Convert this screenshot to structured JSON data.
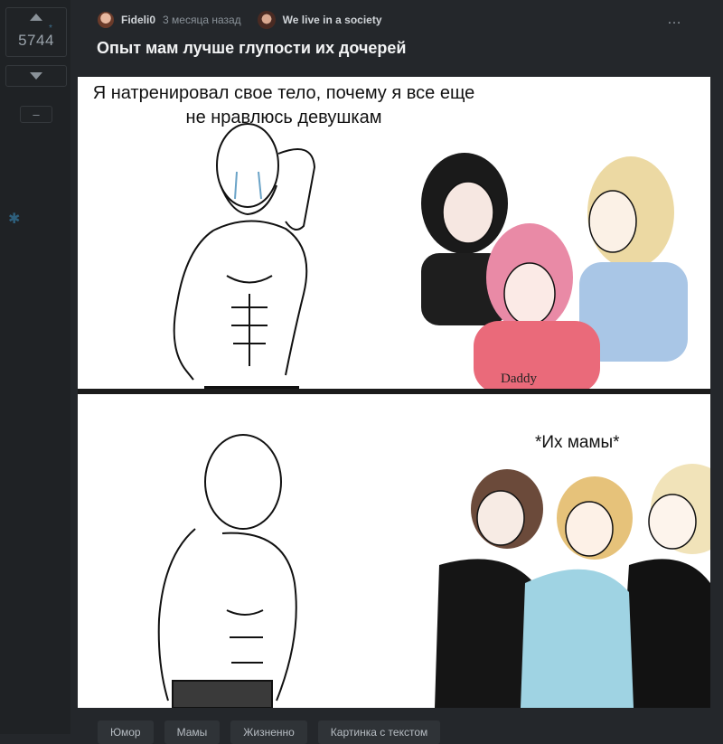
{
  "post": {
    "rating": "5744",
    "author": "Fideli0",
    "time_ago": "3 месяца назад",
    "community": "We live in a society",
    "title": "Опыт мам лучше глупости их дочерей",
    "more_icon": "…",
    "minus_label": "–"
  },
  "image": {
    "top_caption": "Я натренировал свое тело, почему я все еще не нравлюсь девушкам",
    "bottom_caption": "*Их мамы*",
    "shirt_text": "Daddy"
  },
  "tags": [
    "Юмор",
    "Мамы",
    "Жизненно",
    "Картинка с текстом"
  ],
  "colors": {
    "background": "#24272b",
    "rail": "#1f2225",
    "accent_star": "#2e5f7c"
  },
  "icons": {
    "upvote": "triangle-up",
    "downvote": "triangle-down",
    "save": "asterisk"
  }
}
